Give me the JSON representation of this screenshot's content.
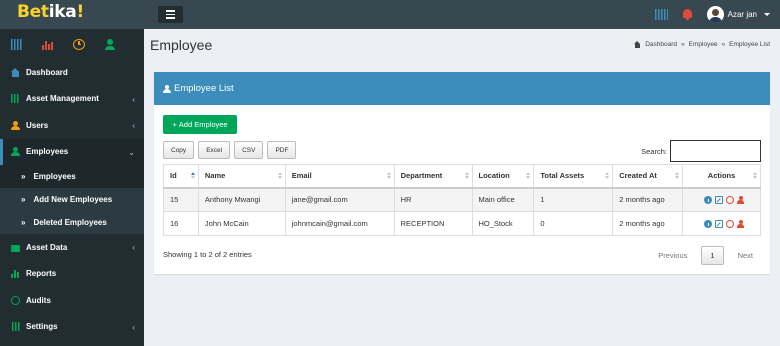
{
  "app": {
    "logo_part1": "Bet",
    "logo_part2": "ika",
    "logo_part3": "!"
  },
  "header": {
    "user_name": "Azar jan"
  },
  "sidebar": {
    "quick_icons": [
      "barcode-icon",
      "bar-chart-icon",
      "clock-icon",
      "user-icon"
    ],
    "items": [
      {
        "label": "Dashboard",
        "icon": "home-icon"
      },
      {
        "label": "Asset Management",
        "icon": "barcode-icon"
      },
      {
        "label": "Users",
        "icon": "user-icon"
      },
      {
        "label": "Employees",
        "icon": "user-icon"
      },
      {
        "label": "Asset Data",
        "icon": "briefcase-icon"
      },
      {
        "label": "Reports",
        "icon": "bar-chart-icon"
      },
      {
        "label": "Audits",
        "icon": "circle-icon"
      },
      {
        "label": "Settings",
        "icon": "sliders-icon"
      }
    ],
    "sub_items": [
      {
        "label": "Employees"
      },
      {
        "label": "Add New Employees"
      },
      {
        "label": "Deleted Employees"
      }
    ]
  },
  "page": {
    "title": "Employee",
    "breadcrumb": [
      "Dashboard",
      "Employee",
      "Employee List"
    ]
  },
  "box": {
    "title": "Employee List",
    "add_button": "Add Employee",
    "export_buttons": [
      "Copy",
      "Excel",
      "CSV",
      "PDF"
    ],
    "search_label": "Search:",
    "search_value": ""
  },
  "table": {
    "columns": [
      "Id",
      "Name",
      "Email",
      "Department",
      "Location",
      "Total Assets",
      "Created At",
      "Actions"
    ],
    "rows": [
      {
        "id": "15",
        "name": "Anthony Mwangi",
        "email": "jane@gmail.com",
        "department": "HR",
        "location": "Main office",
        "total_assets": "1",
        "created_at": "2 months ago"
      },
      {
        "id": "16",
        "name": "John McCain",
        "email": "johnmcain@gmail.com",
        "department": "RECEPTION",
        "location": "HO_Stock",
        "total_assets": "0",
        "created_at": "2 months ago"
      }
    ]
  },
  "footer": {
    "info": "Showing 1 to 2 of 2 entries",
    "pager": {
      "previous": "Previous",
      "current": "1",
      "next": "Next"
    }
  },
  "colors": {
    "accent": "#3c8dbc",
    "success": "#00a65a",
    "danger": "#dd4b39",
    "warning": "#f39c12",
    "sidebar": "#222d32",
    "logo_yellow": "#fcd22b"
  }
}
